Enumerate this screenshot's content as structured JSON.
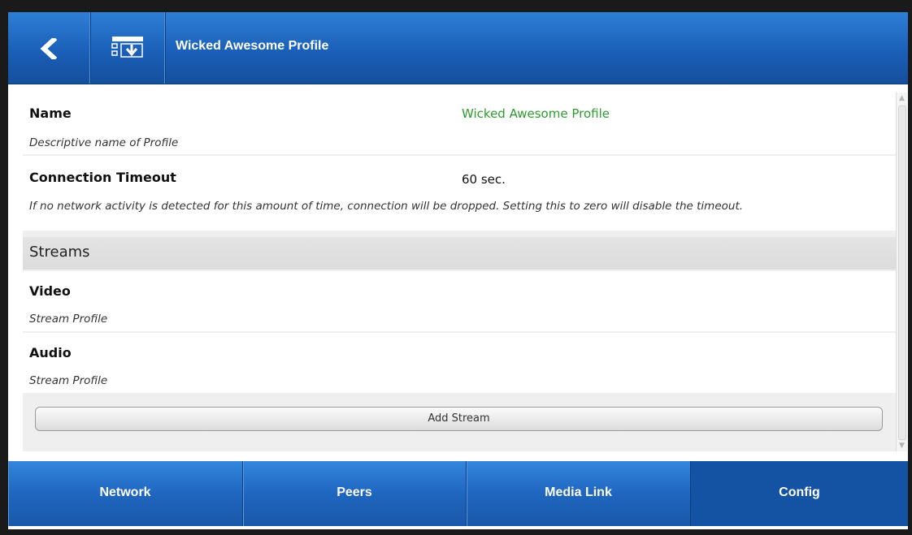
{
  "header": {
    "title": "Wicked Awesome Profile",
    "back_icon": "chevron-left-icon",
    "save_icon": "download-list-icon",
    "accent": "#1a5fb8"
  },
  "fields": {
    "name": {
      "label": "Name",
      "value": "Wicked Awesome Profile",
      "value_color": "#2e9b2e",
      "description": "Descriptive name of Profile"
    },
    "timeout": {
      "label": "Connection Timeout",
      "value": "60 sec.",
      "description": "If no network activity is detected for this amount of time, connection will be dropped. Setting this to zero will disable the timeout."
    }
  },
  "streams": {
    "heading": "Streams",
    "items": [
      {
        "label": "Video",
        "description": "Stream Profile"
      },
      {
        "label": "Audio",
        "description": "Stream Profile"
      }
    ],
    "add_label": "Add Stream"
  },
  "tabs": [
    {
      "label": "Network",
      "active": false
    },
    {
      "label": "Peers",
      "active": false
    },
    {
      "label": "Media Link",
      "active": false
    },
    {
      "label": "Config",
      "active": true
    }
  ]
}
